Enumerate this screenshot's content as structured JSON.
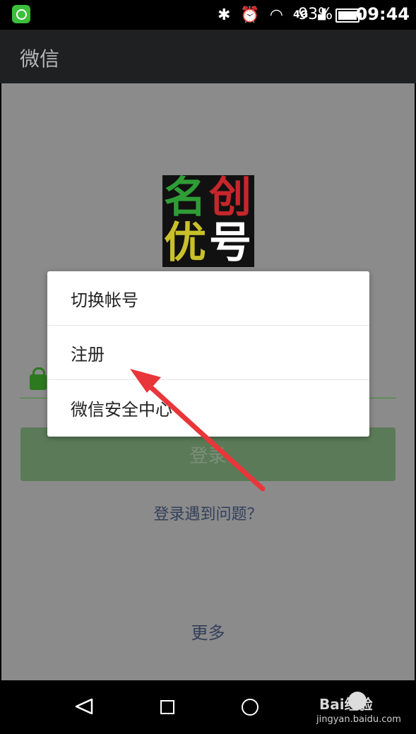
{
  "status_bar": {
    "network_label": "4G",
    "battery_percent": "93%",
    "time": "09:44",
    "icons": [
      "app-notification-icon",
      "bluetooth-icon",
      "alarm-icon",
      "wifi-icon",
      "4g-icon",
      "signal-icon",
      "battery-icon"
    ]
  },
  "app_bar": {
    "title": "微信"
  },
  "logo": {
    "chars": [
      "名",
      "创",
      "优",
      "号"
    ]
  },
  "login": {
    "button_label": "登录",
    "trouble_link": "登录遇到问题？",
    "more_link": "更多"
  },
  "menu": {
    "items": [
      {
        "label": "切换帐号"
      },
      {
        "label": "注册"
      },
      {
        "label": "微信安全中心"
      }
    ]
  },
  "annotation": {
    "arrow_color": "#e8363a"
  },
  "nav_bar": {
    "watermark": "Bai经验",
    "watermark_url": "jingyan.baidu.com"
  }
}
